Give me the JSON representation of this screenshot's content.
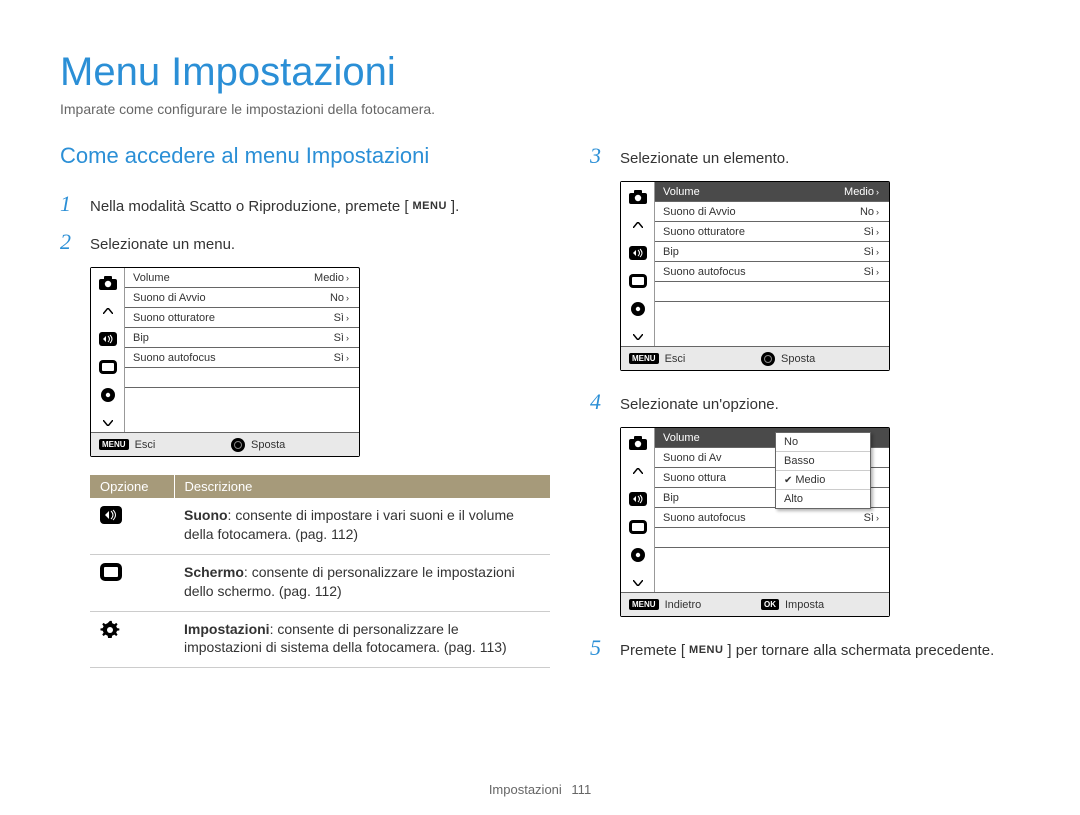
{
  "title": "Menu Impostazioni",
  "subtitle": "Imparate come configurare le impostazioni della fotocamera.",
  "section_title": "Come accedere al menu Impostazioni",
  "steps": {
    "s1_pre": "Nella modalità Scatto o Riproduzione, premete [",
    "s1_badge": "MENU",
    "s1_post": "].",
    "s2": "Selezionate un menu.",
    "s3": "Selezionate un elemento.",
    "s4": "Selezionate un'opzione.",
    "s5_pre": "Premete [",
    "s5_badge": "MENU",
    "s5_post": "] per tornare alla schermata precedente."
  },
  "screen_rows": [
    {
      "label": "Volume",
      "value": "Medio"
    },
    {
      "label": "Suono di Avvio",
      "value": "No"
    },
    {
      "label": "Suono otturatore",
      "value": "Sì"
    },
    {
      "label": "Bip",
      "value": "Sì"
    },
    {
      "label": "Suono autofocus",
      "value": "Sì"
    }
  ],
  "screen3_rows_left": [
    "Volume",
    "Suono di Av",
    "Suono ottura",
    "Bip",
    "Suono autofocus"
  ],
  "screen3_last_value": "Sì",
  "dropdown": [
    "No",
    "Basso",
    "Medio",
    "Alto"
  ],
  "dropdown_selected": "Medio",
  "footer": {
    "menu_key": "MENU",
    "ok_key": "OK",
    "esci": "Esci",
    "sposta": "Sposta",
    "indietro": "Indietro",
    "imposta": "Imposta"
  },
  "options_table": {
    "head_opzione": "Opzione",
    "head_descrizione": "Descrizione",
    "rows": [
      {
        "icon": "sound-icon",
        "bold": "Suono",
        "text": ": consente di impostare i vari suoni e il volume della fotocamera. (pag. 112)"
      },
      {
        "icon": "screen-icon",
        "bold": "Schermo",
        "text": ": consente di personalizzare le impostazioni dello schermo. (pag. 112)"
      },
      {
        "icon": "gear-icon",
        "bold": "Impostazioni",
        "text": ": consente di personalizzare le impostazioni di sistema della fotocamera. (pag. 113)"
      }
    ]
  },
  "page_footer_label": "Impostazioni",
  "page_number": "111"
}
